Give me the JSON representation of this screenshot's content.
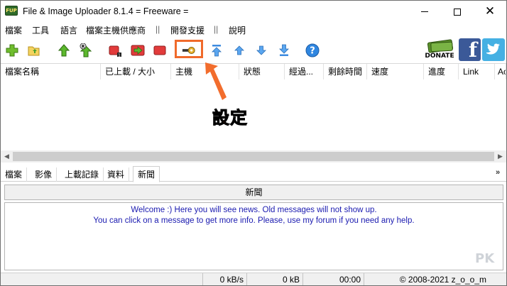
{
  "window": {
    "title": "File & Image Uploader 8.1.4  = Freeware =",
    "app_icon_text": "FUP"
  },
  "menu": {
    "items": [
      "檔案",
      "工具",
      "語言",
      "檔案主機供應商",
      "開發支援",
      "說明"
    ],
    "separator": "||"
  },
  "toolbar": {
    "icons": [
      "add-icon",
      "open-folder-icon",
      "upload-icon",
      "resume-upload-icon",
      "stop-icon",
      "forward-icon",
      "delete-icon",
      "settings-key-icon",
      "move-top-icon",
      "move-up-icon",
      "move-down-icon",
      "move-bottom-icon",
      "help-icon"
    ],
    "donate_label": "DONATE",
    "facebook_letter": "f"
  },
  "list": {
    "columns": [
      "檔案名稱",
      "已上載 / 大小",
      "主機",
      "狀態",
      "經過...",
      "剩餘時間",
      "速度",
      "進度",
      "Link",
      "Ac"
    ]
  },
  "annotation": {
    "text": "設定",
    "color": "#f26d2d"
  },
  "tabs": {
    "items": [
      "檔案",
      "影像",
      "上載記錄",
      "資料",
      "新聞"
    ],
    "active": "新聞",
    "collapse_glyph": "»"
  },
  "news": {
    "header": "新聞",
    "line1": "Welcome :) Here you will see news. Old messages will not show up.",
    "line2": "You can click on a message to get more info. Please, use my forum if you need any help."
  },
  "status": {
    "speed": "0 kB/s",
    "size": "0 kB",
    "time": "00:00",
    "copyright": "© 2008-2021 z_o_o_m"
  },
  "watermark": "PK",
  "colors": {
    "accent": "#f06a2b",
    "news_text": "#1a1ab0",
    "facebook": "#3b5998",
    "twitter": "#45b0e3"
  }
}
